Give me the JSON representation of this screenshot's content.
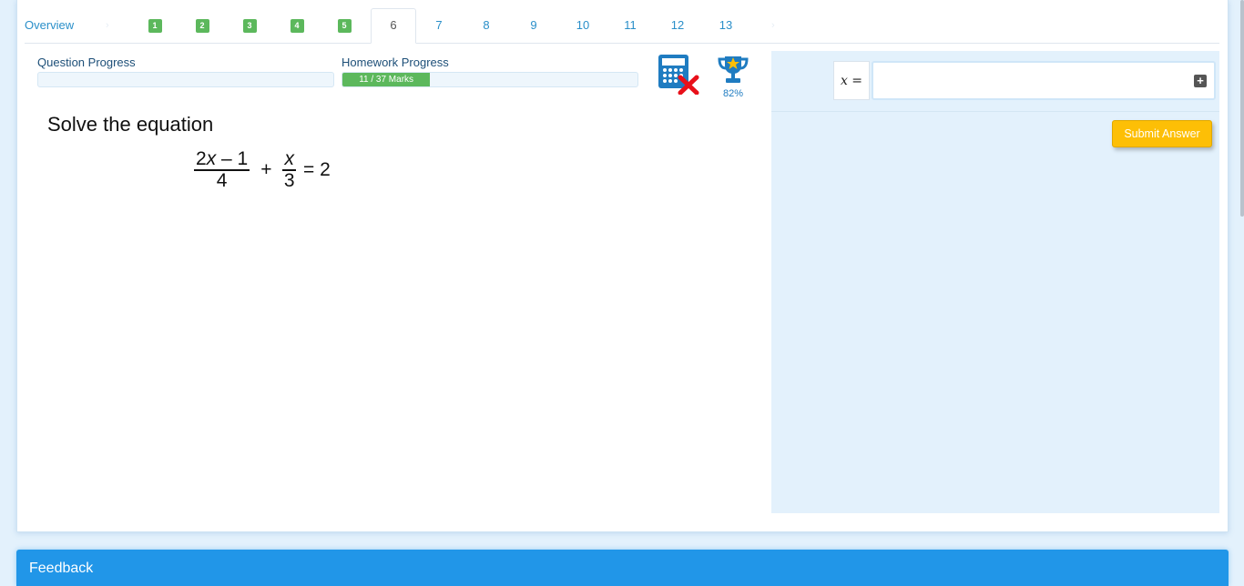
{
  "tabs": {
    "overview": "Overview",
    "completed": [
      "1",
      "2",
      "3",
      "4",
      "5"
    ],
    "active": "6",
    "remaining": [
      "7",
      "8",
      "9",
      "10",
      "11",
      "12",
      "13"
    ]
  },
  "progress": {
    "question_label": "Question Progress",
    "question_fraction": 0,
    "homework_label": "Homework Progress",
    "homework_text": "11 / 37 Marks",
    "homework_fraction": 0.297
  },
  "score": {
    "percent": "82%"
  },
  "question": {
    "title": "Solve the equation",
    "frac1_num_coef": "2",
    "frac1_num_var": "x",
    "frac1_num_rest": " – 1",
    "frac1_den": "4",
    "plus": "+",
    "frac2_num": "x",
    "frac2_den": "3",
    "rhs": "= 2"
  },
  "answer": {
    "variable_label": "x =",
    "value": "",
    "submit_label": "Submit Answer"
  },
  "feedback": {
    "title": "Feedback"
  },
  "colors": {
    "accent": "#2196e8",
    "success": "#5cb85c",
    "submit": "#fdbf06",
    "link": "#2a8fc9"
  },
  "icons": [
    "calculator-disabled-icon",
    "trophy-icon",
    "plus-square-icon"
  ]
}
